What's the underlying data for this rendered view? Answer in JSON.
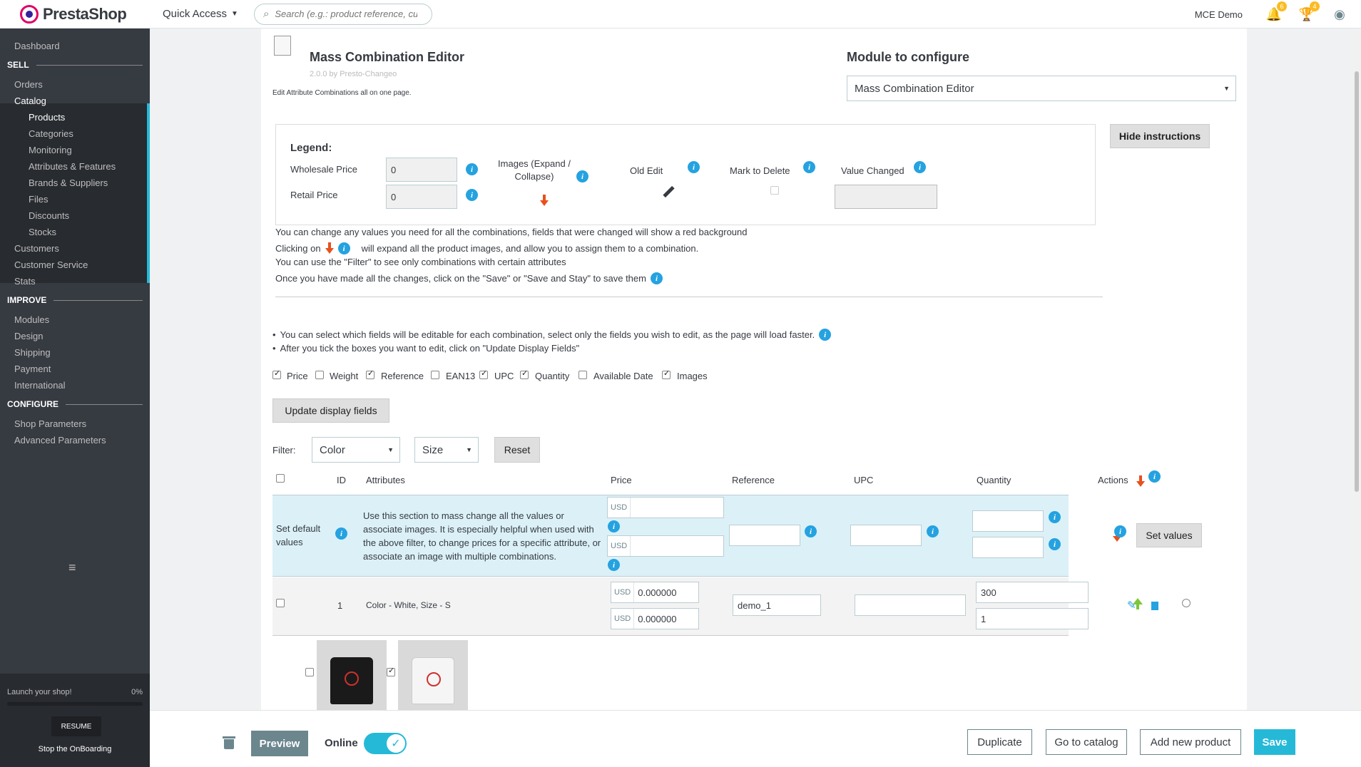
{
  "header": {
    "logo_text": "PrestaShop",
    "quick_access": "Quick Access",
    "search_placeholder": "Search (e.g.: product reference, custo",
    "shop_name": "MCE Demo",
    "notifications_count": "6",
    "orders_count": "4"
  },
  "sidebar": {
    "dashboard": "Dashboard",
    "sell": "SELL",
    "orders": "Orders",
    "catalog": "Catalog",
    "catalog_items": [
      "Products",
      "Categories",
      "Monitoring",
      "Attributes & Features",
      "Brands & Suppliers",
      "Files",
      "Discounts",
      "Stocks"
    ],
    "customers": "Customers",
    "customer_service": "Customer Service",
    "stats": "Stats",
    "improve": "IMPROVE",
    "improve_items": [
      "Modules",
      "Design",
      "Shipping",
      "Payment",
      "International"
    ],
    "configure": "CONFIGURE",
    "configure_items": [
      "Shop Parameters",
      "Advanced Parameters"
    ],
    "launch": "Launch your shop!",
    "launch_pct": "0%",
    "resume": "RESUME",
    "stop_onboarding": "Stop the OnBoarding"
  },
  "module": {
    "title": "Mass Combination Editor",
    "version": "2.0.0 by Presto-Changeo",
    "description": "Edit Attribute Combinations all on one page.",
    "configure_title": "Module to configure",
    "configure_selected": "Mass Combination Editor",
    "hide_instructions": "Hide instructions"
  },
  "legend": {
    "title": "Legend:",
    "wholesale_label": "Wholesale Price",
    "wholesale_value": "0",
    "retail_label": "Retail Price",
    "retail_value": "0",
    "images_label": "Images (Expand / Collapse)",
    "old_edit": "Old Edit",
    "mark_delete": "Mark to Delete",
    "value_changed": "Value Changed"
  },
  "instructions": {
    "line1": "You can change any values you need for all the combinations, fields that were changed will show a red background",
    "line2a": "Clicking on",
    "line2b": "will expand all the product images, and allow you to assign them to a combination.",
    "line3": "You can use the \"Filter\" to see only combinations with certain attributes",
    "line4": "Once you have made all the changes, click on the \"Save\" or \"Save and Stay\" to save them",
    "bullet1": "You can select which fields will be editable for each combination, select only the fields you wish to edit, as the page will load faster.",
    "bullet2": "After you tick the boxes you want to edit, click on \"Update Display Fields\""
  },
  "fields": [
    {
      "label": "Price",
      "checked": true
    },
    {
      "label": "Weight",
      "checked": false
    },
    {
      "label": "Reference",
      "checked": true
    },
    {
      "label": "EAN13",
      "checked": false
    },
    {
      "label": "UPC",
      "checked": true
    },
    {
      "label": "Quantity",
      "checked": true
    },
    {
      "label": "Available Date",
      "checked": false
    },
    {
      "label": "Images",
      "checked": true
    }
  ],
  "update_display_fields": "Update display fields",
  "filter": {
    "label": "Filter:",
    "color": "Color",
    "size": "Size",
    "reset": "Reset"
  },
  "table": {
    "headers": {
      "id": "ID",
      "attributes": "Attributes",
      "price": "Price",
      "reference": "Reference",
      "upc": "UPC",
      "quantity": "Quantity",
      "actions": "Actions"
    },
    "defaults_label": "Set default values",
    "defaults_text": "Use this section to mass change all the values or associate images. It is especially helpful when used with the above filter, to change prices for a specific attribute, or associate an image with multiple combinations.",
    "currency": "USD",
    "set_values": "Set values",
    "row": {
      "id": "1",
      "attributes": "Color - White, Size - S",
      "price1": "0.000000",
      "price2": "0.000000",
      "reference": "demo_1",
      "upc": "",
      "qty1": "300",
      "qty2": "1"
    }
  },
  "footer": {
    "preview": "Preview",
    "online": "Online",
    "duplicate": "Duplicate",
    "go_catalog": "Go to catalog",
    "add_new": "Add new product",
    "save": "Save"
  }
}
